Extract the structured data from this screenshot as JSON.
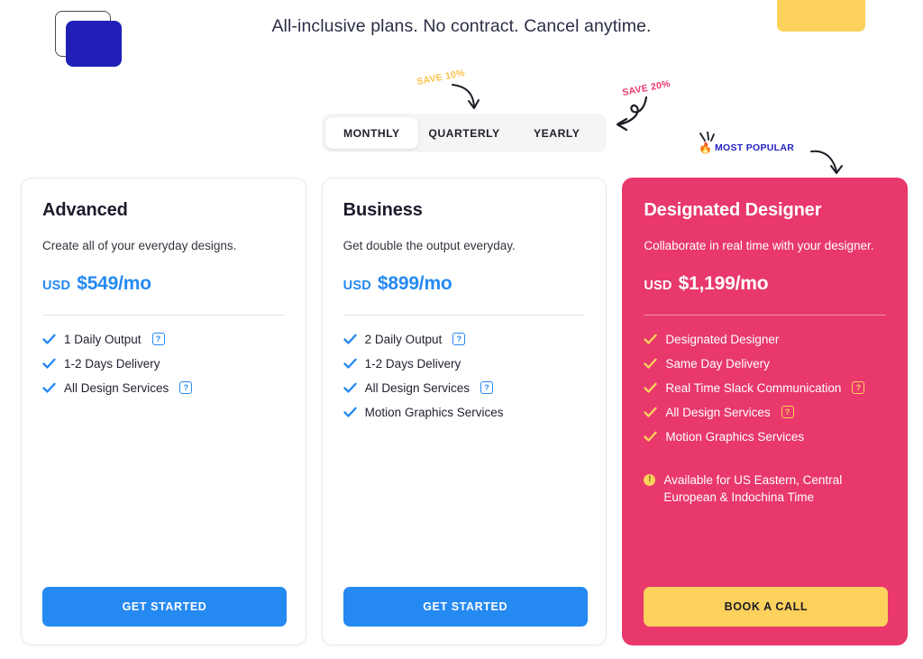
{
  "header": {
    "headline": "All-inclusive plans. No contract. Cancel anytime.",
    "logo_name": "brand-logo",
    "top_cta_label": ""
  },
  "annotations": {
    "save_quarterly": "SAVE 10%",
    "save_yearly": "SAVE 20%",
    "most_popular": "MOST POPULAR",
    "flame_icon": "🔥"
  },
  "billing_toggle": {
    "options": [
      {
        "label": "MONTHLY",
        "active": true
      },
      {
        "label": "QUARTERLY",
        "active": false
      },
      {
        "label": "YEARLY",
        "active": false
      }
    ]
  },
  "colors": {
    "accent_blue": "#2589f2",
    "featured_pink": "#e8386c",
    "accent_yellow": "#fcd15c",
    "logo_blue": "#2020b8",
    "popular_blue": "#2323c4"
  },
  "plans": [
    {
      "name": "Advanced",
      "subtitle": "Create all of your everyday designs.",
      "currency": "USD",
      "price": "$549/mo",
      "featured": false,
      "features": [
        {
          "label": "1 Daily Output",
          "help": true
        },
        {
          "label": "1-2 Days Delivery",
          "help": false
        },
        {
          "label": "All Design Services",
          "help": true
        }
      ],
      "cta_label": "GET STARTED"
    },
    {
      "name": "Business",
      "subtitle": "Get double the output everyday.",
      "currency": "USD",
      "price": "$899/mo",
      "featured": false,
      "features": [
        {
          "label": "2 Daily Output",
          "help": true
        },
        {
          "label": "1-2 Days Delivery",
          "help": false
        },
        {
          "label": "All Design Services",
          "help": true
        },
        {
          "label": "Motion Graphics Services",
          "help": false
        }
      ],
      "cta_label": "GET STARTED"
    },
    {
      "name": "Designated Designer",
      "subtitle": "Collaborate in real time with your designer.",
      "currency": "USD",
      "price": "$1,199/mo",
      "featured": true,
      "features": [
        {
          "label": "Designated Designer",
          "help": false
        },
        {
          "label": "Same Day Delivery",
          "help": false
        },
        {
          "label": "Real Time Slack Communication",
          "help": true
        },
        {
          "label": "All Design Services",
          "help": true
        },
        {
          "label": "Motion Graphics Services",
          "help": false
        }
      ],
      "note": "Available for US Eastern, Central European & Indochina Time",
      "note_icon": "!",
      "cta_label": "BOOK A CALL"
    }
  ],
  "help_glyph": "?"
}
